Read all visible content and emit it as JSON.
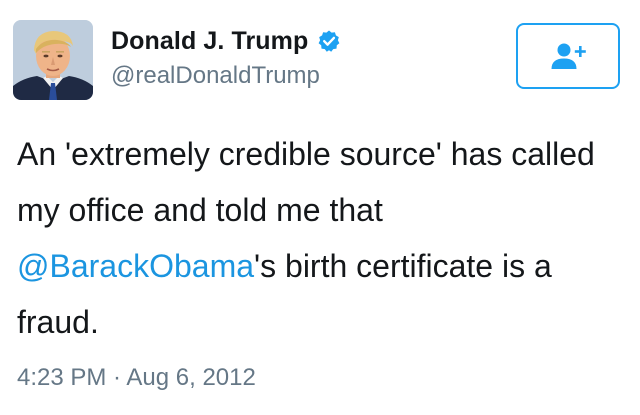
{
  "author": {
    "display_name": "Donald J. Trump",
    "username": "@realDonaldTrump",
    "verified": true,
    "avatar_icon": "profile-photo"
  },
  "follow_button": {
    "icon": "add-user-icon",
    "accent_color": "#1da1f2"
  },
  "tweet": {
    "text_before": "An 'extremely credible source' has called my office and told me that ",
    "mention": "@BarackObama",
    "text_after": "'s birth certificate is a fraud.",
    "mention_color": "#1b95e0"
  },
  "meta": {
    "timestamp": "4:23 PM · Aug 6, 2012"
  }
}
